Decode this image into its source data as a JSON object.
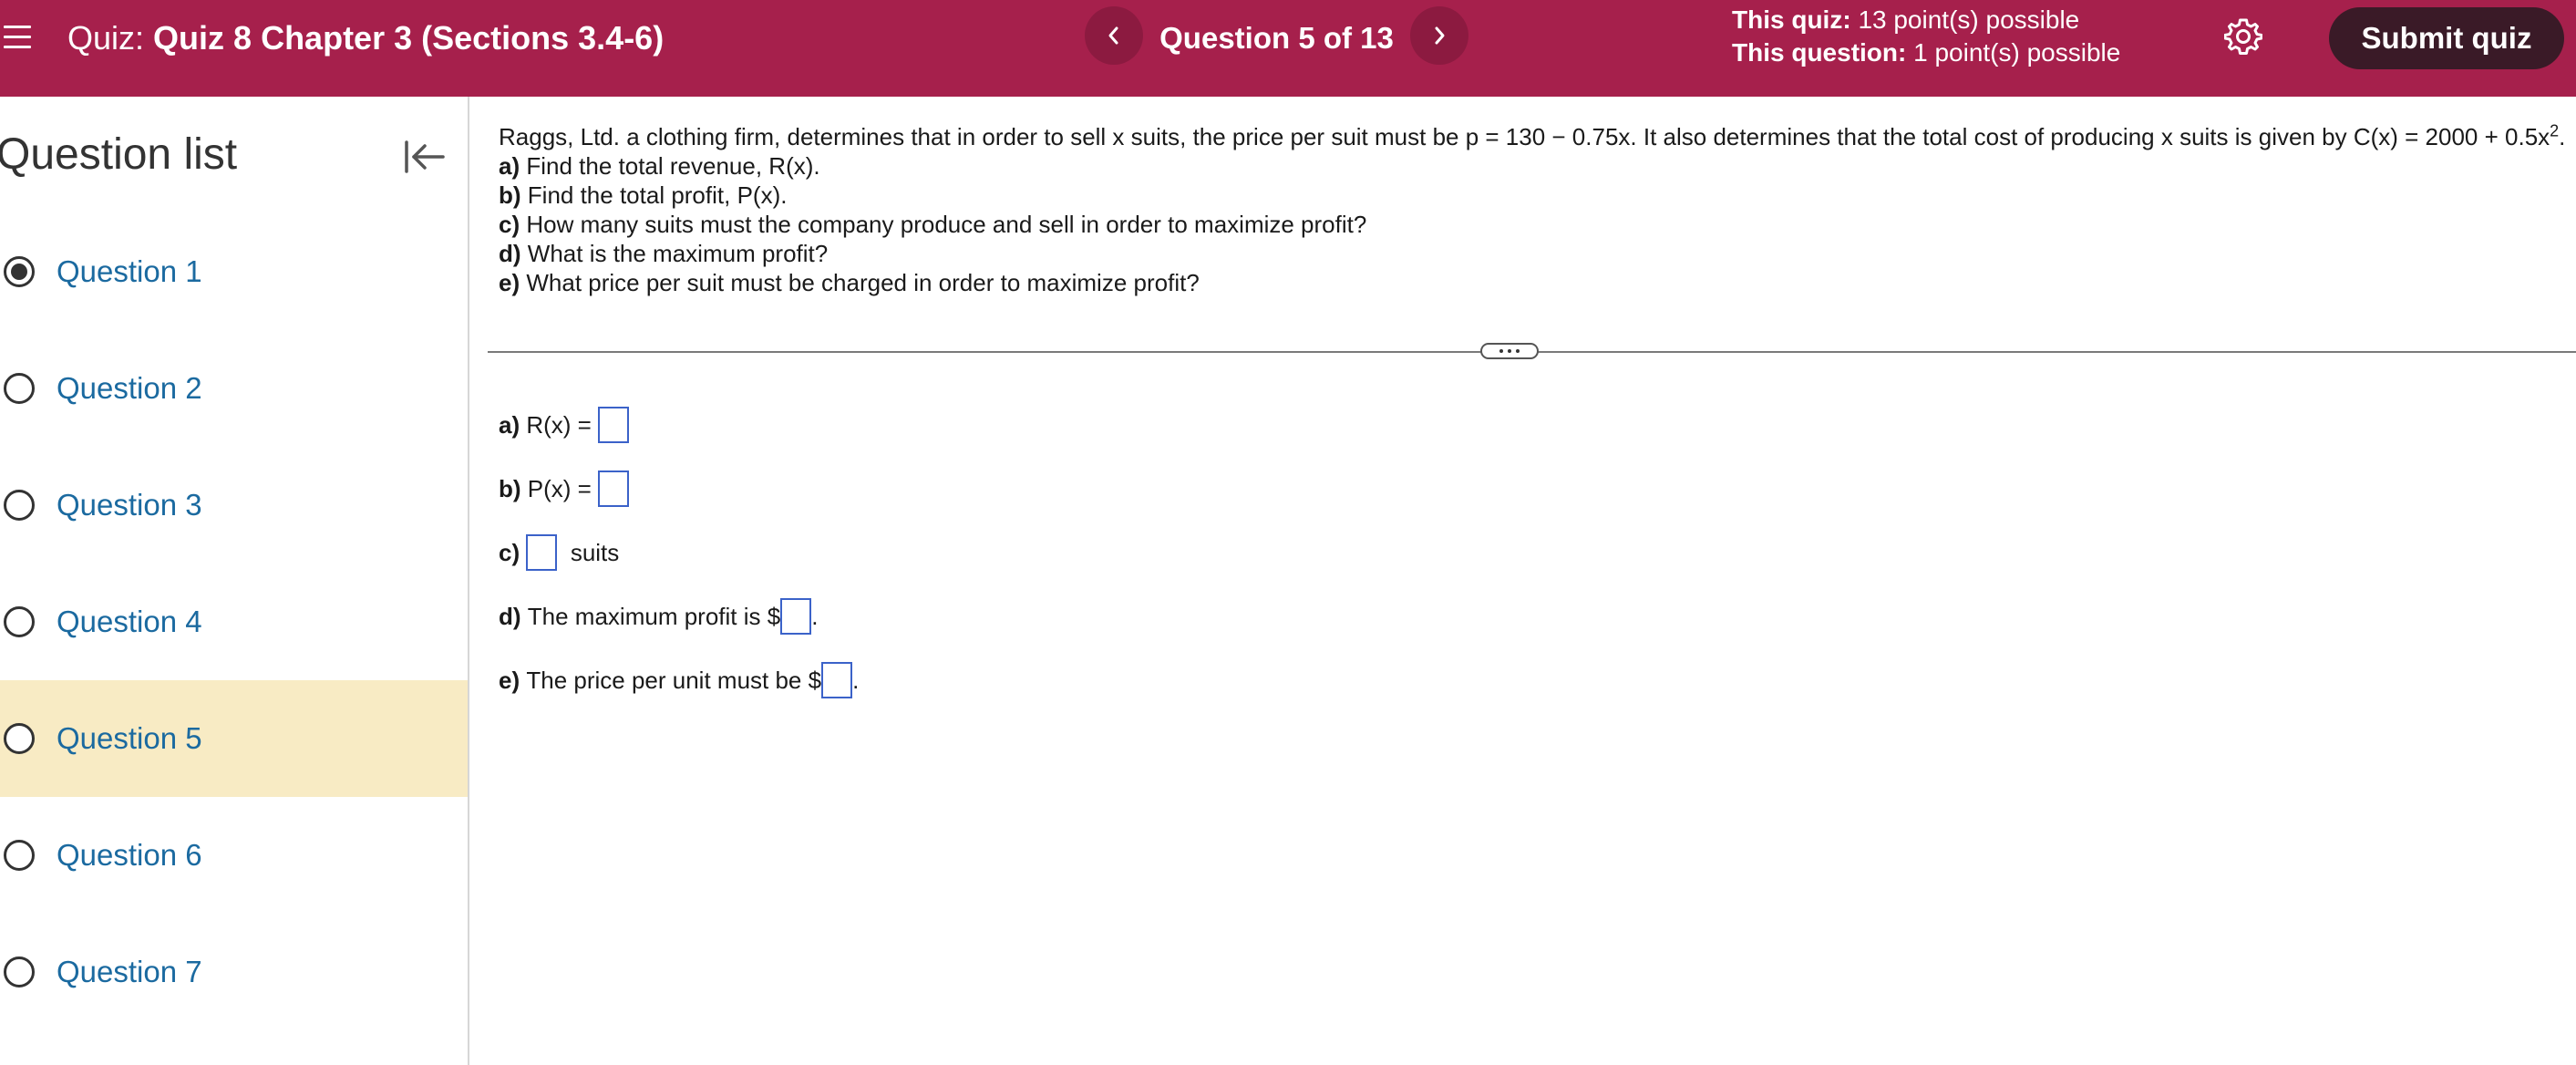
{
  "header": {
    "quiz_prefix": "Quiz:",
    "quiz_name": "Quiz 8 Chapter 3 (Sections 3.4-6)",
    "question_counter": "Question 5 of 13",
    "quiz_points_label": "This quiz:",
    "quiz_points_value": "13 point(s) possible",
    "question_points_label": "This question:",
    "question_points_value": "1 point(s) possible",
    "submit_label": "Submit quiz",
    "prev_glyph": "‹",
    "next_glyph": "›"
  },
  "sidebar": {
    "title": "Question list",
    "items": [
      {
        "label": "Question 1",
        "state": "answered"
      },
      {
        "label": "Question 2",
        "state": "unanswered"
      },
      {
        "label": "Question 3",
        "state": "unanswered"
      },
      {
        "label": "Question 4",
        "state": "unanswered"
      },
      {
        "label": "Question 5",
        "state": "current"
      },
      {
        "label": "Question 6",
        "state": "unanswered"
      },
      {
        "label": "Question 7",
        "state": "unanswered"
      }
    ]
  },
  "question": {
    "stem_part1": "Raggs, Ltd. a clothing firm, determines that in order to sell x suits, the price per suit must be p = 130 − 0.75x. It also determines that the total cost of producing x suits is given by C(x) = 2000 + 0.5x",
    "stem_exponent": "2",
    "stem_end": ".",
    "parts": [
      {
        "letter": "a)",
        "text": "Find the total revenue, R(x)."
      },
      {
        "letter": "b)",
        "text": "Find the total profit, P(x)."
      },
      {
        "letter": "c)",
        "text": "How many suits must the company produce and sell in order to maximize profit?"
      },
      {
        "letter": "d)",
        "text": "What is the maximum profit?"
      },
      {
        "letter": "e)",
        "text": "What price per suit must be charged in order to maximize profit?"
      }
    ]
  },
  "answers": {
    "a_letter": "a)",
    "a_text": "R(x) =",
    "b_letter": "b)",
    "b_text": "P(x) =",
    "c_letter": "c)",
    "c_suffix": "suits",
    "d_letter": "d)",
    "d_text": "The maximum profit is $",
    "d_end": ".",
    "e_letter": "e)",
    "e_text": "The price per unit must be $",
    "e_end": "."
  },
  "colors": {
    "header_bg": "#a6204c",
    "submit_bg": "#3a1a27",
    "current_item_bg": "#f8ebc4",
    "link_blue": "#1b6aa0",
    "input_border": "#3b62c9"
  },
  "icons": [
    "menu-icon",
    "chevron-left-icon",
    "chevron-right-icon",
    "gear-icon",
    "collapse-left-icon",
    "radio-icon",
    "ellipsis-icon"
  ]
}
